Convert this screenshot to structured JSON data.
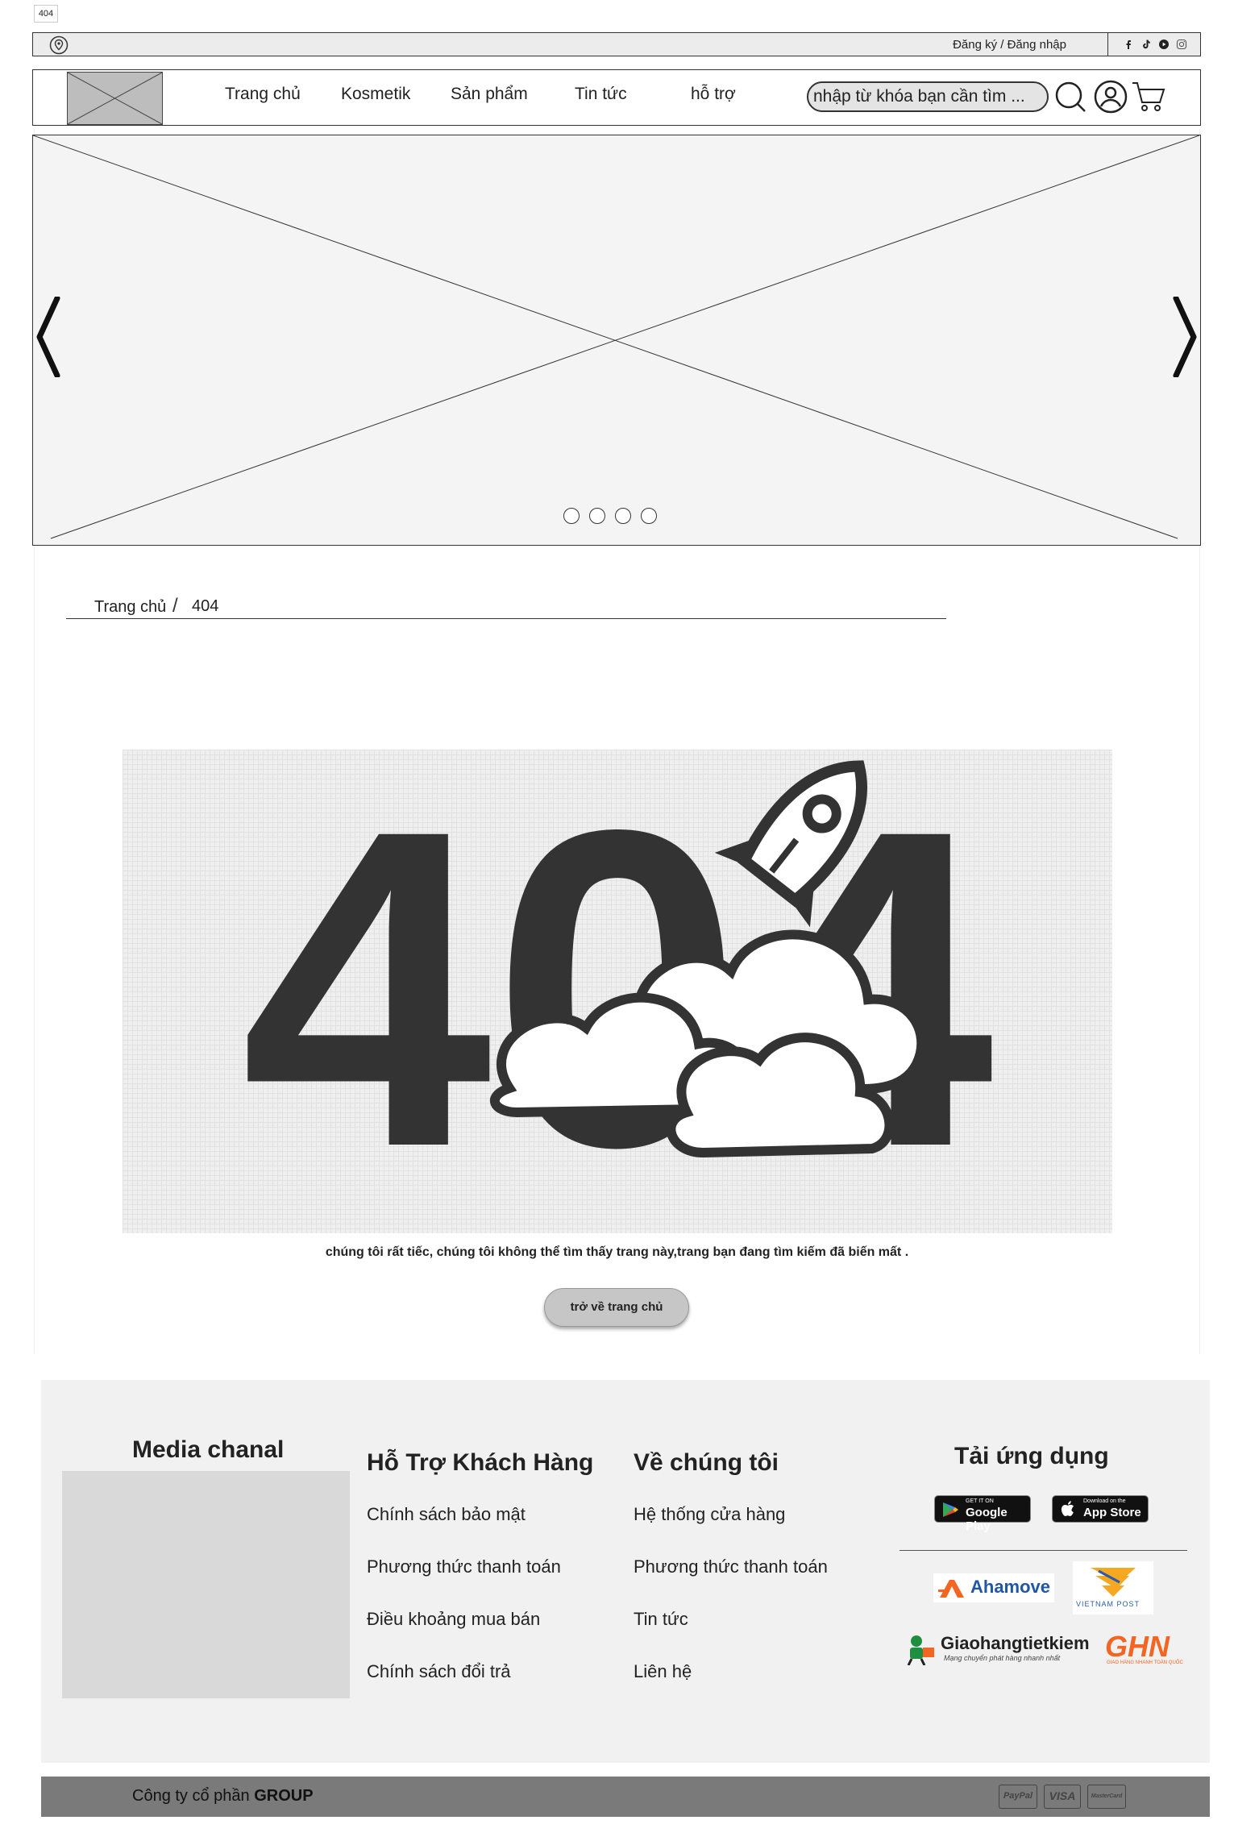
{
  "page_tag": "404",
  "topbar": {
    "auth_text": "Đăng ký / Đăng nhập",
    "location_icon": "location-pin-icon",
    "social_icons": [
      "facebook-icon",
      "tiktok-icon",
      "youtube-icon",
      "instagram-icon"
    ]
  },
  "header": {
    "nav": [
      "Trang chủ",
      "Kosmetik",
      "Sản phẩm",
      "Tin tức",
      "hỗ trợ"
    ],
    "search_placeholder": "nhập từ khóa bạn cần tìm ...",
    "icons": [
      "search-icon",
      "user-account-icon",
      "shopping-cart-icon"
    ]
  },
  "banner": {
    "slide_count": 4,
    "prev_icon": "chevron-left-icon",
    "next_icon": "chevron-right-icon"
  },
  "breadcrumb": {
    "home": "Trang chủ",
    "current": "404"
  },
  "error": {
    "code": "404",
    "message": "chúng tôi rất tiếc, chúng tôi không thể tìm thấy trang này,trang bạn đang tìm kiếm đã biến mất .",
    "button": "trở về trang chủ"
  },
  "footer": {
    "media": {
      "title": "Media chanal"
    },
    "support": {
      "title": "Hỗ Trợ Khách Hàng",
      "links": [
        "Chính sách bảo mật",
        "Phương thức thanh toán",
        "Điều khoảng mua bán",
        "Chính sách đổi trả"
      ]
    },
    "about": {
      "title": "Về chúng tôi",
      "links": [
        "Hệ thống cửa hàng",
        "Phương thức thanh toán",
        "Tin tức",
        "Liên hệ"
      ]
    },
    "app": {
      "title": "Tải ứng dụng",
      "google_small": "GET IT ON",
      "google_big": "Google Play",
      "apple_small": "Download on the",
      "apple_big": "App Store"
    },
    "shipping": {
      "ahamove": "Ahamove",
      "vnpost": "VIETNAM POST",
      "ghtk": "Giaohangtietkiem",
      "ghtk_sub": "Mạng chuyển phát hàng nhanh nhất",
      "ghn": "GHN",
      "ghn_sub": "GIAO HÀNG NHANH TOÀN QUỐC"
    }
  },
  "bottom": {
    "company_prefix": "Công ty cổ phần ",
    "company_name": "GROUP",
    "payments": [
      "PayPal",
      "VISA",
      "MasterCard"
    ]
  }
}
